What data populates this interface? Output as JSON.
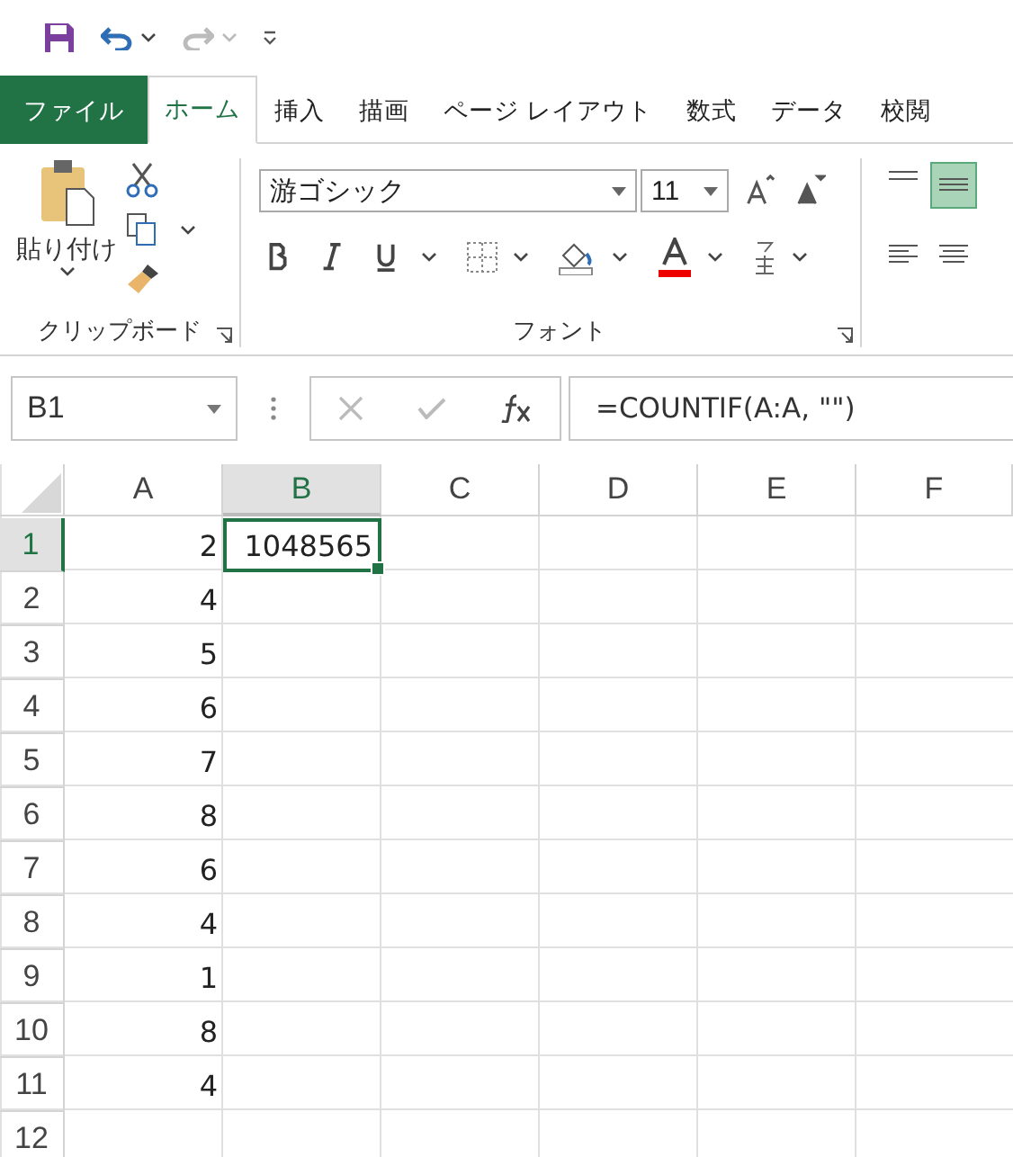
{
  "tabs": [
    {
      "label": "ファイル",
      "kind": "file",
      "selected": false
    },
    {
      "label": "ホーム",
      "kind": "tab",
      "selected": true
    },
    {
      "label": "挿入",
      "kind": "tab",
      "selected": false
    },
    {
      "label": "描画",
      "kind": "tab",
      "selected": false
    },
    {
      "label": "ページ レイアウト",
      "kind": "tab",
      "selected": false
    },
    {
      "label": "数式",
      "kind": "tab",
      "selected": false
    },
    {
      "label": "データ",
      "kind": "tab",
      "selected": false
    },
    {
      "label": "校閲",
      "kind": "tab",
      "selected": false
    }
  ],
  "ribbon": {
    "clipboard": {
      "paste_label": "貼り付け",
      "label": "クリップボード"
    },
    "font": {
      "font_name": "游ゴシック",
      "font_size": "11",
      "label": "フォント"
    },
    "alignment": [
      {
        "selected": false
      },
      {
        "selected": true
      }
    ]
  },
  "formula_bar": {
    "name_box": "B1",
    "formula": "=COUNTIF(A:A, \"\")"
  },
  "grid": {
    "columns": [
      {
        "label": "A",
        "selected": false
      },
      {
        "label": "B",
        "selected": true
      },
      {
        "label": "C",
        "selected": false
      },
      {
        "label": "D",
        "selected": false
      },
      {
        "label": "E",
        "selected": false
      },
      {
        "label": "F",
        "selected": false
      }
    ],
    "rows": [
      {
        "header": "1",
        "selected": true,
        "cells": [
          "2",
          "1048565"
        ]
      },
      {
        "header": "2",
        "selected": false,
        "cells": [
          "4"
        ]
      },
      {
        "header": "3",
        "selected": false,
        "cells": [
          "5"
        ]
      },
      {
        "header": "4",
        "selected": false,
        "cells": [
          "6"
        ]
      },
      {
        "header": "5",
        "selected": false,
        "cells": [
          "7"
        ]
      },
      {
        "header": "6",
        "selected": false,
        "cells": [
          "8"
        ]
      },
      {
        "header": "7",
        "selected": false,
        "cells": [
          "6"
        ]
      },
      {
        "header": "8",
        "selected": false,
        "cells": [
          "4"
        ]
      },
      {
        "header": "9",
        "selected": false,
        "cells": [
          "1"
        ]
      },
      {
        "header": "10",
        "selected": false,
        "cells": [
          "8"
        ]
      },
      {
        "header": "11",
        "selected": false,
        "cells": [
          "4"
        ]
      },
      {
        "header": "12",
        "selected": false,
        "cells": []
      }
    ]
  }
}
